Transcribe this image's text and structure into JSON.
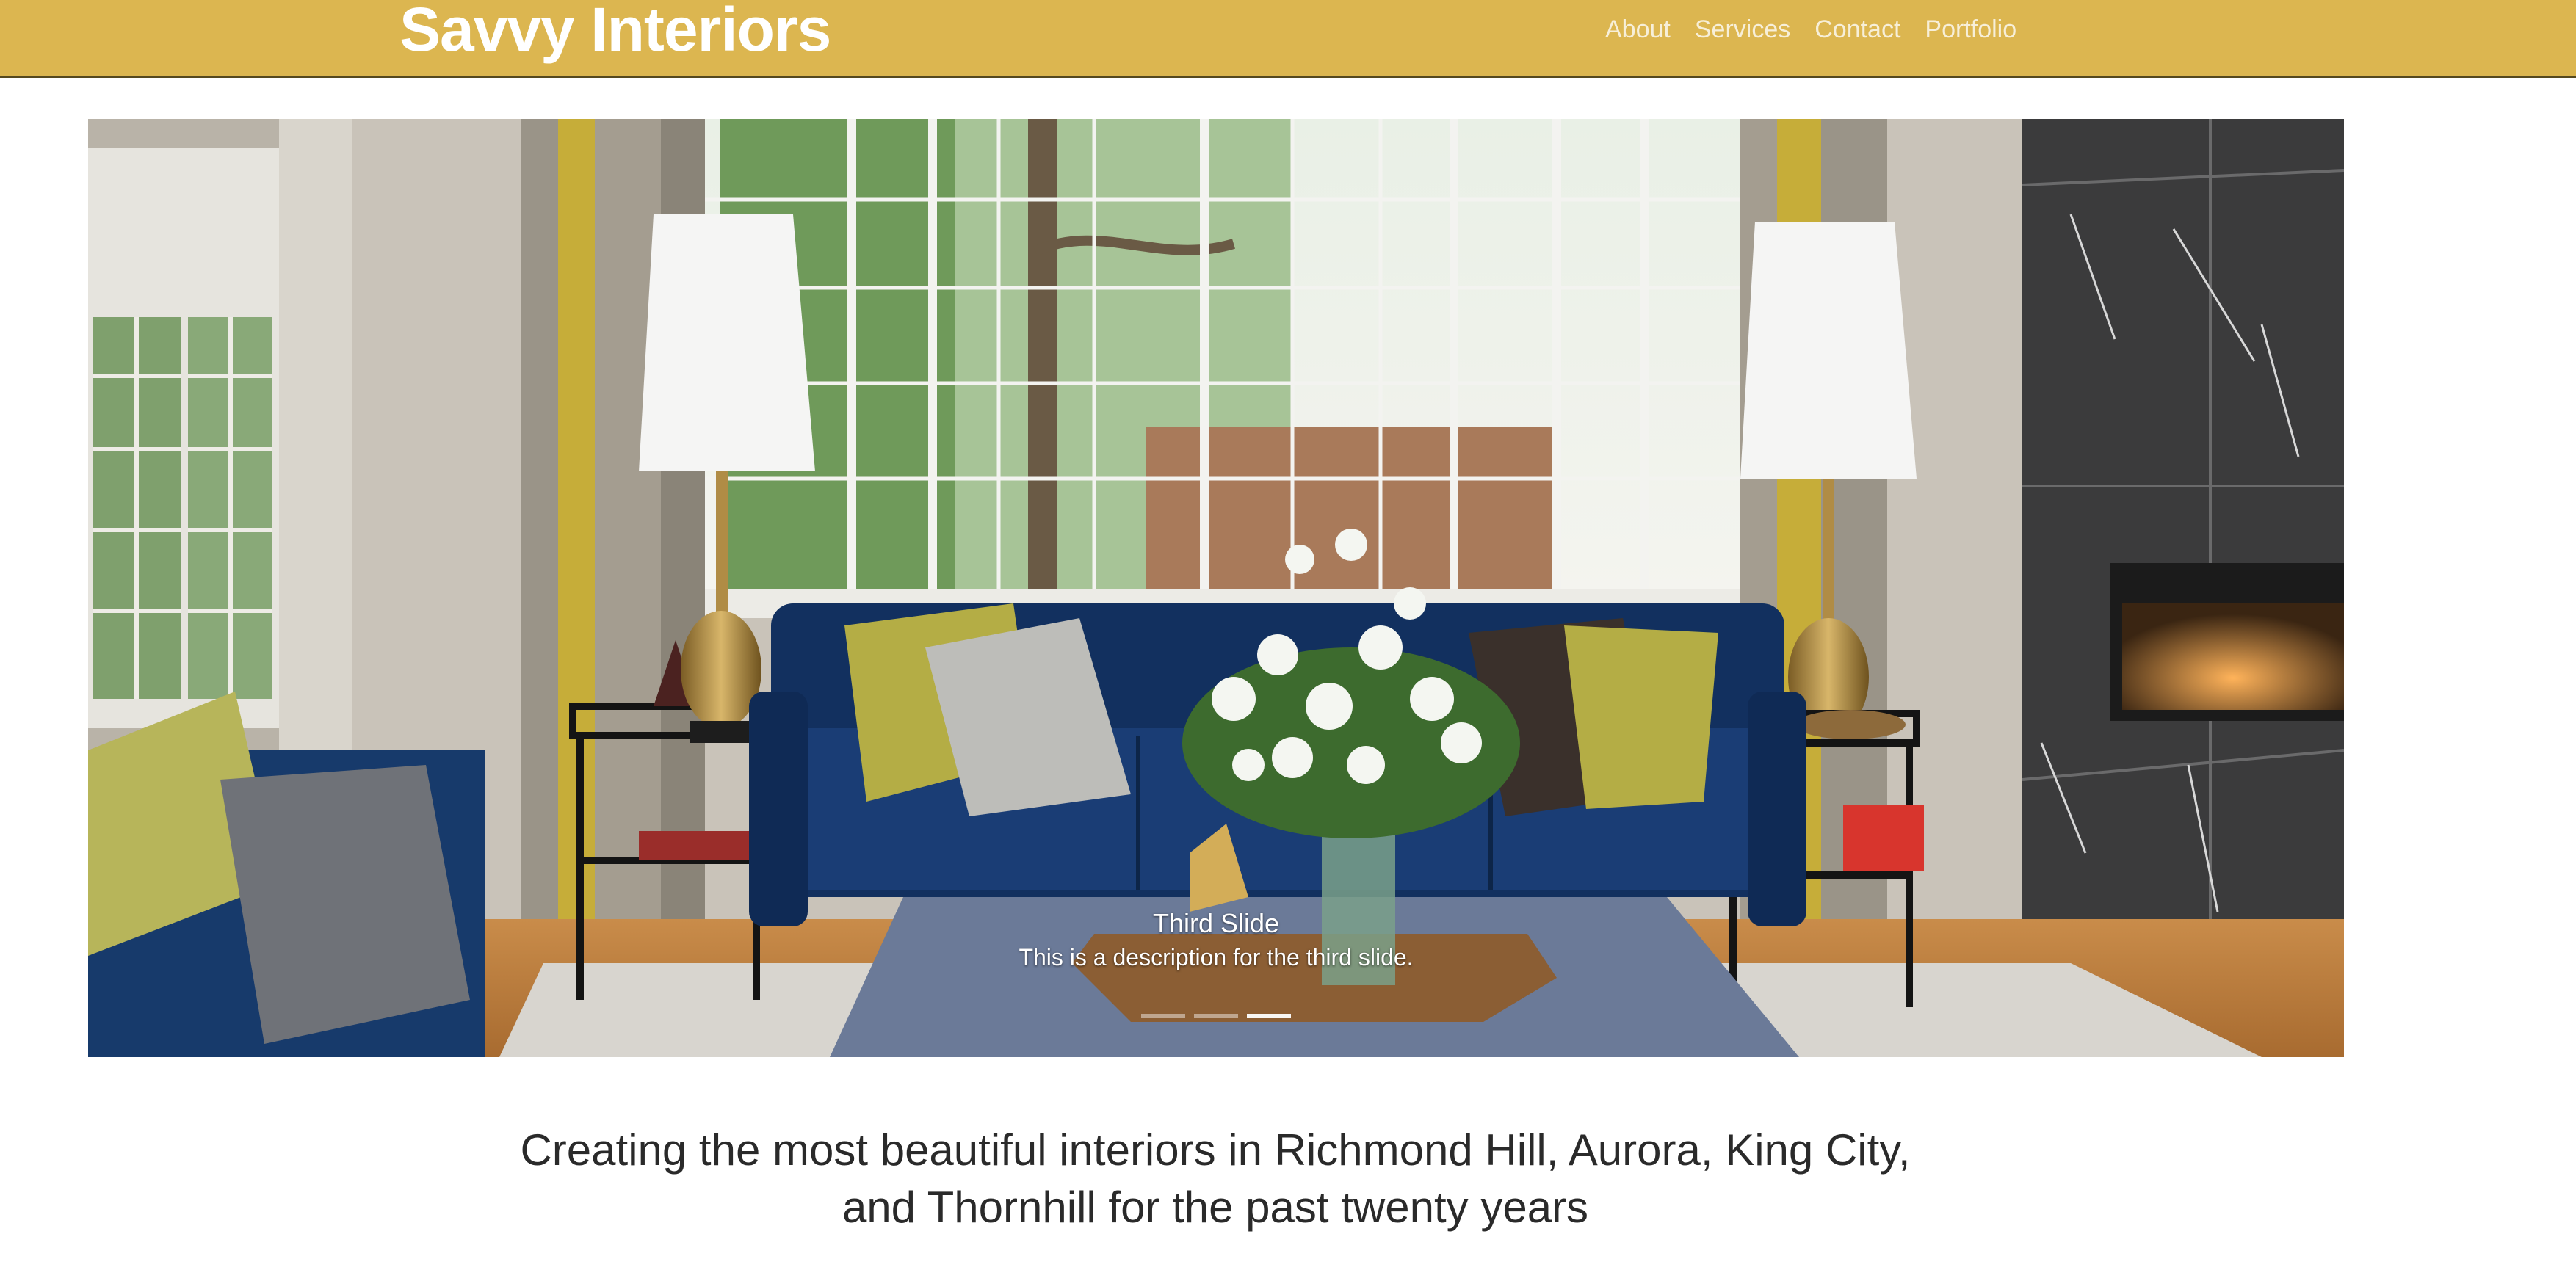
{
  "navbar": {
    "brand": "Savvy Interiors",
    "links": [
      "About",
      "Services",
      "Contact",
      "Portfolio"
    ],
    "background_color": "#dcb650"
  },
  "carousel": {
    "slide_title": "Third Slide",
    "slide_description": "This is a description for the third slide.",
    "indicator_count": 3,
    "active_indicator": 3
  },
  "main": {
    "tagline": "Creating the most beautiful interiors in Richmond Hill, Aurora, King City, and Thornhill for the past twenty years"
  }
}
